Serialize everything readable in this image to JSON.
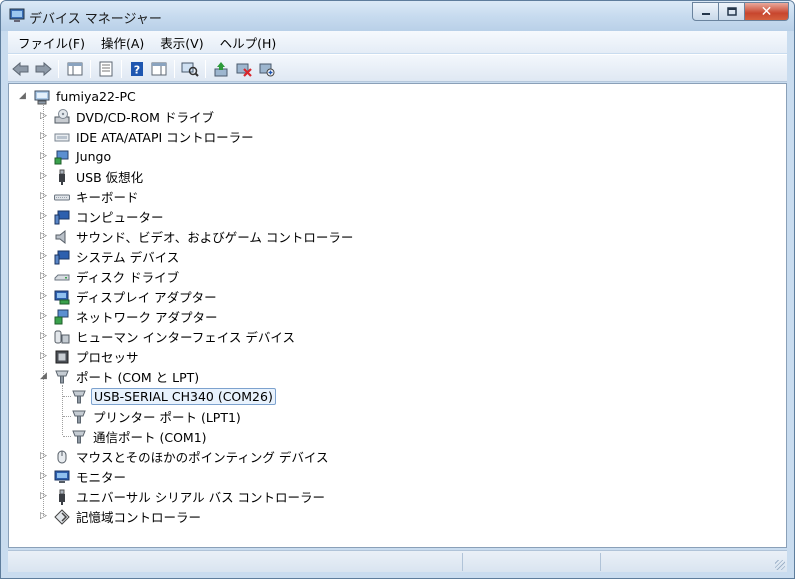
{
  "window": {
    "title": "デバイス マネージャー",
    "close_symbol": "✕"
  },
  "menu": [
    "ファイル(F)",
    "操作(A)",
    "表示(V)",
    "ヘルプ(H)"
  ],
  "toolbar": {
    "icons": [
      "back-icon",
      "forward-icon",
      "show-hide-console-tree-icon",
      "properties-icon",
      "help-icon",
      "action-pane-icon",
      "scan-hardware-icon",
      "update-driver-icon",
      "uninstall-icon",
      "disable-device-icon"
    ],
    "accent_blue": "#1e56b0",
    "accent_red": "#d8262c",
    "accent_green": "#2c9a3a"
  },
  "tree": {
    "root": "fumiya22-PC",
    "categories": [
      {
        "label": "DVD/CD-ROM ドライブ",
        "icon": "dvd-drive-icon"
      },
      {
        "label": "IDE ATA/ATAPI コントローラー",
        "icon": "ide-controller-icon"
      },
      {
        "label": "Jungo",
        "icon": "jungo-device-icon"
      },
      {
        "label": "USB 仮想化",
        "icon": "usb-virtualization-icon"
      },
      {
        "label": "キーボード",
        "icon": "keyboard-icon"
      },
      {
        "label": "コンピューター",
        "icon": "computer-icon"
      },
      {
        "label": "サウンド、ビデオ、およびゲーム コントローラー",
        "icon": "speaker-icon"
      },
      {
        "label": "システム デバイス",
        "icon": "system-devices-icon"
      },
      {
        "label": "ディスク ドライブ",
        "icon": "disk-drive-icon"
      },
      {
        "label": "ディスプレイ アダプター",
        "icon": "display-adapter-icon"
      },
      {
        "label": "ネットワーク アダプター",
        "icon": "network-adapter-icon"
      },
      {
        "label": "ヒューマン インターフェイス デバイス",
        "icon": "hid-icon"
      },
      {
        "label": "プロセッサ",
        "icon": "processor-icon"
      },
      {
        "label": "ポート (COM と LPT)",
        "icon": "port-icon",
        "expanded": true,
        "children": [
          "USB-SERIAL CH340 (COM26)",
          "プリンター ポート (LPT1)",
          "通信ポート (COM1)"
        ]
      },
      {
        "label": "マウスとそのほかのポインティング デバイス",
        "icon": "mouse-icon"
      },
      {
        "label": "モニター",
        "icon": "monitor-icon"
      },
      {
        "label": "ユニバーサル シリアル バス コントローラー",
        "icon": "usb-controller-icon"
      },
      {
        "label": "記憶域コントローラー",
        "icon": "storage-controller-icon"
      }
    ],
    "selected_child": "USB-SERIAL CH340 (COM26)",
    "selection_color": "#e8f2fd"
  }
}
